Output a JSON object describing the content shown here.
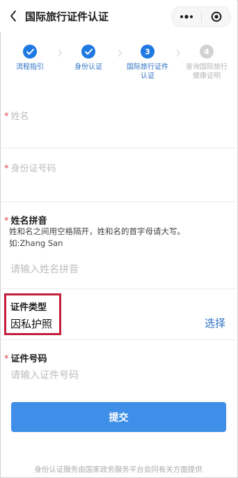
{
  "header": {
    "title": "国际旅行证件认证",
    "more_icon": "more-dots-icon",
    "close_icon": "target-close-icon"
  },
  "steps": [
    {
      "label_line1": "流程指引",
      "label_line2": "",
      "state": "done",
      "number": ""
    },
    {
      "label_line1": "身份认证",
      "label_line2": "",
      "state": "done",
      "number": ""
    },
    {
      "label_line1": "国际旅行证件",
      "label_line2": "认证",
      "state": "current",
      "number": "3"
    },
    {
      "label_line1": "查询国际旅行",
      "label_line2": "健康证明",
      "state": "todo",
      "number": "4"
    }
  ],
  "form": {
    "name": {
      "required_mark": "*",
      "placeholder": "姓名"
    },
    "id_number": {
      "required_mark": "*",
      "placeholder": "身份证号码"
    },
    "pinyin": {
      "required_mark": "*",
      "label": "姓名拼音",
      "hint_line1": "姓和名之间用空格隔开，姓和名的首字母请大写。",
      "hint_line2": "如:Zhang San",
      "placeholder": "请输入姓名拼音"
    },
    "doc_type": {
      "label": "证件类型",
      "value": "因私护照",
      "select_label": "选择"
    },
    "doc_number": {
      "required_mark": "*",
      "label": "证件号码",
      "placeholder": "请输入证件号码"
    }
  },
  "submit_label": "提交",
  "footer_text": "身份认证服务由国家政务服务平台会同有关方面提供",
  "colors": {
    "accent": "#1e7ae2",
    "button": "#3f8ee8",
    "required": "#e04545",
    "highlight": "#c41e3a"
  }
}
